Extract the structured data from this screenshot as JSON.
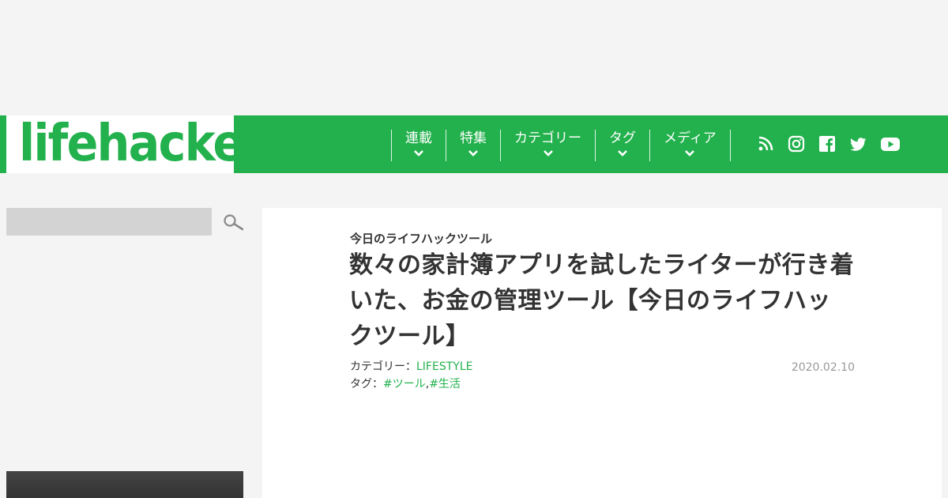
{
  "brand": {
    "logo_text": "lifehacker",
    "accent_color": "#22b14c"
  },
  "nav": {
    "items": [
      {
        "label": "連載"
      },
      {
        "label": "特集"
      },
      {
        "label": "カテゴリー"
      },
      {
        "label": "タグ"
      },
      {
        "label": "メディア"
      }
    ],
    "social_icons": [
      "rss-icon",
      "instagram-icon",
      "facebook-icon",
      "twitter-icon",
      "youtube-icon"
    ]
  },
  "search": {
    "placeholder": ""
  },
  "article": {
    "kicker": "今日のライフハックツール",
    "title": "数々の家計簿アプリを試したライターが行き着いた、お金の管理ツール【今日のライフハックツール】",
    "category_label": "カテゴリー：",
    "category_value": "LIFESTYLE",
    "tag_label": "タグ：",
    "tags": [
      "#ツール",
      "#生活"
    ],
    "tag_separator": ",",
    "date": "2020.02.10"
  }
}
